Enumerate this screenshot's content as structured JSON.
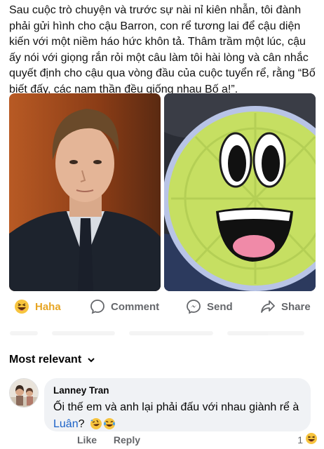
{
  "post": {
    "text": "Sau cuộc trò chuyện và trước sự nài nỉ kiên nhẫn, tôi đành phải gửi hình cho cậu Barron, con rể tương lai để cậu diện kiến với một niềm háo hức khôn tả. Thâm trầm một lúc, cậu ấy nói với giọng rắn rỏi một câu làm tôi hài lòng và cân nhắc quyết định cho cậu qua vòng đầu của cuộc tuyển rể, rằng “Bố biết đấy, các nam thần đều giống nhau Bố ạ!”."
  },
  "actions": {
    "haha": "Haha",
    "comment": "Comment",
    "send": "Send",
    "share": "Share"
  },
  "comments_section": {
    "sort_label": "Most relevant"
  },
  "comment": {
    "author": "Lanney Tran",
    "text_before": "Ối thế em và anh lại phải đấu với nhau giành rể à ",
    "mention": "Luân",
    "text_after": "?",
    "like_label": "Like",
    "reply_label": "Reply",
    "reaction_count": "1"
  },
  "colors": {
    "haha_accent": "#e7a523",
    "link_blue": "#1a61c7",
    "muted_text": "#65676b",
    "bubble_bg": "#f0f2f5"
  }
}
